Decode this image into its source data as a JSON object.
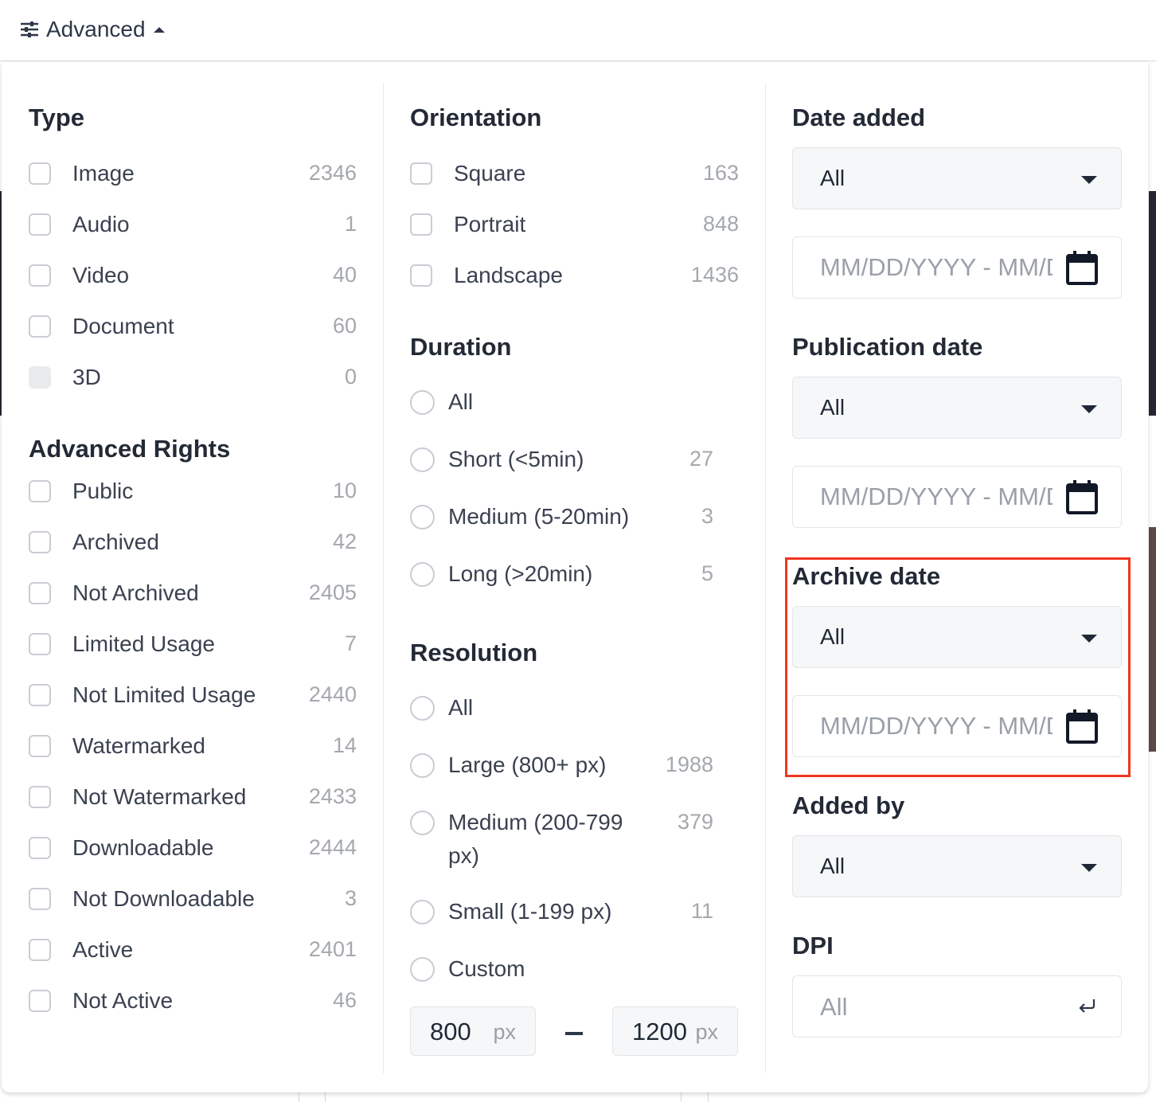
{
  "header": {
    "advanced_label": "Advanced"
  },
  "type": {
    "heading": "Type",
    "items": [
      {
        "label": "Image",
        "count": "2346"
      },
      {
        "label": "Audio",
        "count": "1"
      },
      {
        "label": "Video",
        "count": "40"
      },
      {
        "label": "Document",
        "count": "60"
      },
      {
        "label": "3D",
        "count": "0",
        "disabled": true
      }
    ]
  },
  "advanced_rights": {
    "heading": "Advanced Rights",
    "items": [
      {
        "label": "Public",
        "count": "10"
      },
      {
        "label": "Archived",
        "count": "42"
      },
      {
        "label": "Not Archived",
        "count": "2405"
      },
      {
        "label": "Limited Usage",
        "count": "7"
      },
      {
        "label": "Not Limited Usage",
        "count": "2440"
      },
      {
        "label": "Watermarked",
        "count": "14"
      },
      {
        "label": "Not Watermarked",
        "count": "2433"
      },
      {
        "label": "Downloadable",
        "count": "2444"
      },
      {
        "label": "Not Downloadable",
        "count": "3"
      },
      {
        "label": "Active",
        "count": "2401"
      },
      {
        "label": "Not Active",
        "count": "46"
      }
    ]
  },
  "orientation": {
    "heading": "Orientation",
    "items": [
      {
        "label": "Square",
        "count": "163"
      },
      {
        "label": "Portrait",
        "count": "848"
      },
      {
        "label": "Landscape",
        "count": "1436"
      }
    ]
  },
  "duration": {
    "heading": "Duration",
    "items": [
      {
        "label": "All",
        "count": ""
      },
      {
        "label": "Short (<5min)",
        "count": "27"
      },
      {
        "label": "Medium (5-20min)",
        "count": "3"
      },
      {
        "label": "Long (>20min)",
        "count": "5"
      }
    ]
  },
  "resolution": {
    "heading": "Resolution",
    "items": [
      {
        "label": "All",
        "count": ""
      },
      {
        "label": "Large (800+ px)",
        "count": "1988"
      },
      {
        "label": "Medium (200-799",
        "label2": "px)",
        "count": "379"
      },
      {
        "label": "Small (1-199 px)",
        "count": "11"
      },
      {
        "label": "Custom",
        "count": ""
      }
    ],
    "custom_min": "800",
    "custom_max": "1200",
    "unit": "px"
  },
  "date_added": {
    "heading": "Date added",
    "selected": "All",
    "placeholder": "MM/DD/YYYY - MM/DD/YYYY"
  },
  "publication_date": {
    "heading": "Publication date",
    "selected": "All",
    "placeholder": "MM/DD/YYYY - MM/DD/YYYY"
  },
  "archive_date": {
    "heading": "Archive date",
    "selected": "All",
    "placeholder": "MM/DD/YYYY - MM/DD/YYYY"
  },
  "added_by": {
    "heading": "Added by",
    "selected": "All"
  },
  "dpi": {
    "heading": "DPI",
    "placeholder": "All"
  },
  "colors": {
    "highlight": "#f0351f",
    "checkbox_border": "#c9cdd3",
    "count_text": "#a4a8ae"
  }
}
